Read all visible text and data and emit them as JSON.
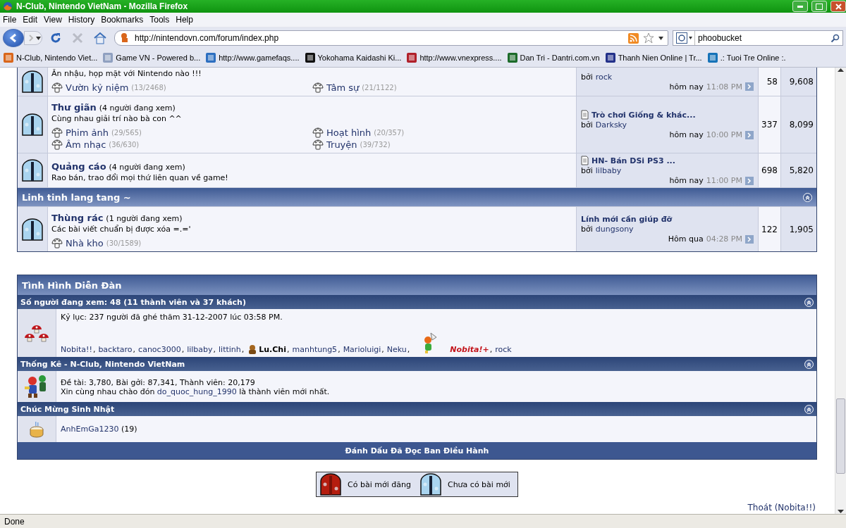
{
  "window": {
    "title": "N-Club, Nintendo VietNam - Mozilla Firefox"
  },
  "menu": [
    "File",
    "Edit",
    "View",
    "History",
    "Bookmarks",
    "Tools",
    "Help"
  ],
  "address_bar": {
    "url": "http://nintendovn.com/forum/index.php"
  },
  "search": {
    "value": "phoobucket"
  },
  "bookmarks": [
    {
      "label": "N-Club, Nintendo Viet...",
      "kind": "mario"
    },
    {
      "label": "Game VN - Powered b...",
      "kind": "page"
    },
    {
      "label": "http://www.gamefaqs....",
      "kind": "blue"
    },
    {
      "label": "Yokohama Kaidashi Ki...",
      "kind": "black"
    },
    {
      "label": "http://www.vnexpress....",
      "kind": "red"
    },
    {
      "label": "Dan Tri - Dantri.com.vn",
      "kind": "green"
    },
    {
      "label": "Thanh Nien Online | Tr...",
      "kind": "navy"
    },
    {
      "label": ".: Tuoi Tre Online :.",
      "kind": "teal"
    }
  ],
  "forum_rows": [
    {
      "kind": "forum",
      "description": "Ăn nhậu, họp mặt với Nintendo nào !!!",
      "subforums": [
        {
          "name": "Vườn kỷ niệm",
          "count": "(13/2468)"
        },
        {
          "name": "Tâm sự",
          "count": "(21/1122)"
        }
      ],
      "last_post": {
        "by_label": "bởi",
        "author": "rock",
        "day": "hôm nay",
        "time": "11:08 PM"
      },
      "threads": "58",
      "posts": "9,608"
    },
    {
      "kind": "forum",
      "title": "Thư giãn",
      "viewers": "(4 người đang xem)",
      "description": "Cùng nhau giải trí nào bà con ^^",
      "subforums": [
        {
          "name": "Phim ảnh",
          "count": "(29/565)"
        },
        {
          "name": "Hoạt hình",
          "count": "(20/357)"
        },
        {
          "name": "Âm nhạc",
          "count": "(36/630)"
        },
        {
          "name": "Truyện",
          "count": "(39/732)"
        }
      ],
      "last_post": {
        "title": "Trò chơi Giống & khác...",
        "post_icon": true,
        "by_label": "bởi",
        "author": "Darksky",
        "day": "hôm nay",
        "time": "10:00 PM"
      },
      "threads": "337",
      "posts": "8,099"
    },
    {
      "kind": "forum",
      "title": "Quảng cáo",
      "viewers": "(4 người đang xem)",
      "description": "Rao bán, trao đổi mọi thứ liên quan về game!",
      "last_post": {
        "title": "HN- Bán DSi PS3 ...",
        "post_icon": true,
        "by_label": "bởi",
        "author": "lilbaby",
        "day": "hôm nay",
        "time": "11:00 PM"
      },
      "threads": "698",
      "posts": "5,820"
    },
    {
      "kind": "category",
      "title": "Linh tinh lang tang ~"
    },
    {
      "kind": "forum",
      "title": "Thùng rác",
      "viewers": "(1 người đang xem)",
      "description": "Các bài viết chuẩn bị được xóa =.='",
      "subforums": [
        {
          "name": "Nhà kho",
          "count": "(30/1589)"
        }
      ],
      "last_post": {
        "title": "Lính mới cần giúp đỡ",
        "post_icon": false,
        "by_label": "bởi",
        "author": "dungsony",
        "day": "Hôm qua",
        "time": "04:28 PM"
      },
      "threads": "122",
      "posts": "1,905"
    }
  ],
  "stats_panel": {
    "title": "Tình Hình Diễn Đàn",
    "sections": [
      {
        "kind": "online",
        "heading": "Số người đang xem: 48 (11 thành viên và 37 khách)",
        "record": "Kỷ lục: 237 người đã ghé thăm 31-12-2007 lúc 03:58 PM.",
        "separator": ",",
        "users": [
          {
            "name": "Nobita!!",
            "kind": "member"
          },
          {
            "name": "backtaro",
            "kind": "member"
          },
          {
            "name": "canoc3000",
            "kind": "member"
          },
          {
            "name": "lilbaby",
            "kind": "member"
          },
          {
            "name": "littinh",
            "kind": "member"
          },
          {
            "name": "Lu.Chi",
            "kind": "moderator"
          },
          {
            "name": "manhtung5",
            "kind": "member"
          },
          {
            "name": "Marioluigi",
            "kind": "member"
          },
          {
            "name": "Neku",
            "kind": "member"
          },
          {
            "name": "Nobita!+",
            "kind": "admin"
          },
          {
            "name": "rock",
            "kind": "member"
          }
        ]
      },
      {
        "kind": "stats",
        "heading": "Thống Kê - N-Club, Nintendo VietNam",
        "totals": "Đề tài: 3,780, Bài gởi: 87,341, Thành viên: 20,179",
        "welcome_before": "Xin cùng nhau chào đón",
        "welcome_user": "do_quoc_hung_1990",
        "welcome_after": "là thành viên mới nhất."
      },
      {
        "kind": "birthday",
        "heading": "Chúc Mừng Sinh Nhật",
        "user": "AnhEmGa1230",
        "age": "(19)"
      }
    ],
    "footer": "Đánh Dấu Đã Đọc Ban Điều Hành"
  },
  "legend": [
    {
      "kind": "new",
      "label": "Có bài mới đăng"
    },
    {
      "kind": "old",
      "label": "Chưa có bài mới"
    }
  ],
  "logout_link": "Thoát (Nobita!!)",
  "status_bar": "Done"
}
